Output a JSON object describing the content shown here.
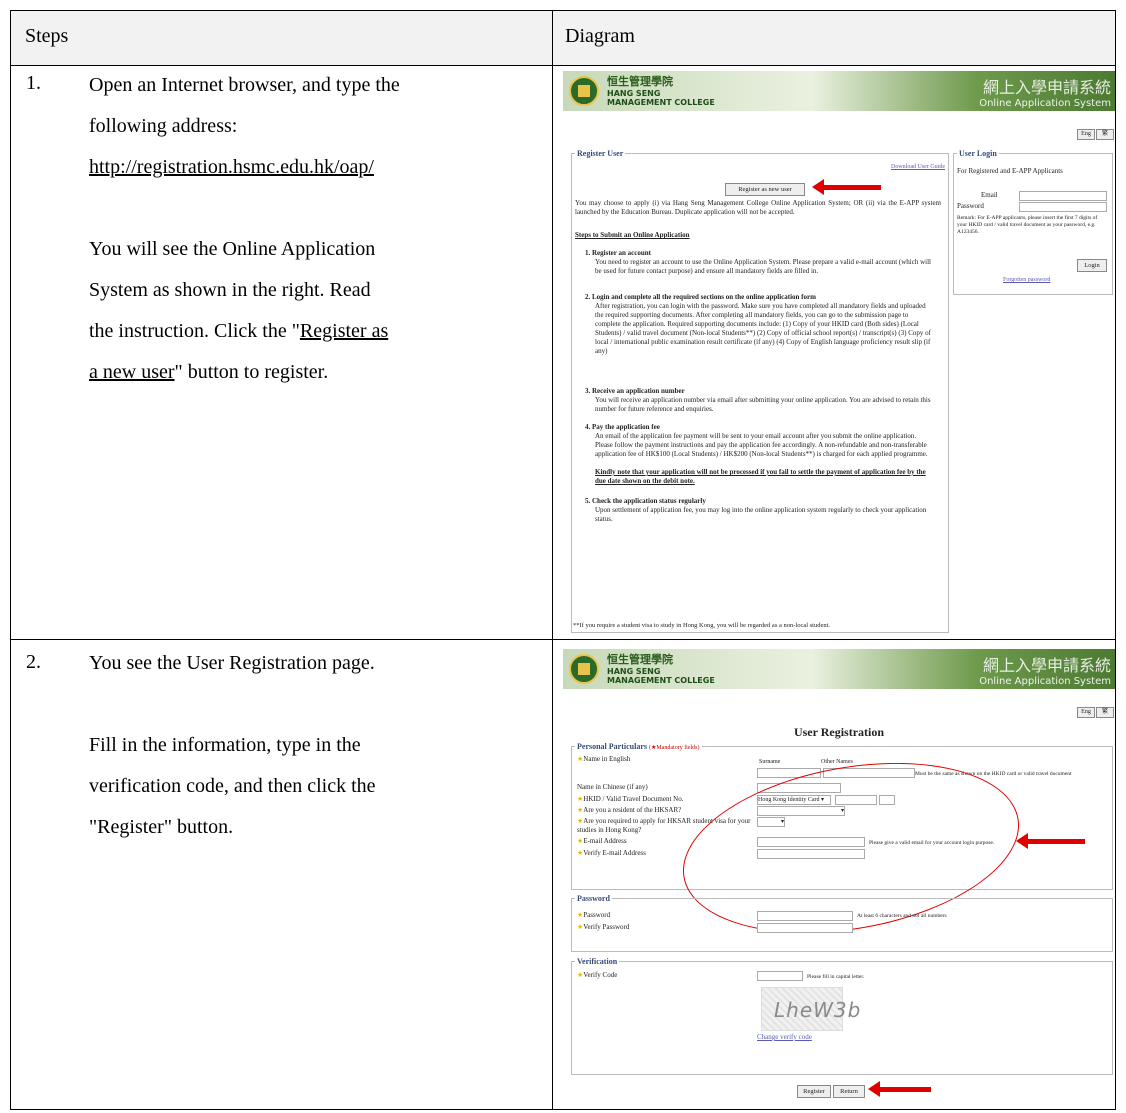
{
  "table": {
    "header_steps": "Steps",
    "header_diagram": "Diagram"
  },
  "step1": {
    "number": "1.",
    "line1": "Open an Internet browser, and type the",
    "line2": "following address:",
    "url": "http://registration.hsmc.edu.hk/oap/",
    "line4": "You will see the Online Application",
    "line5a": "System as shown in the right.   Read",
    "line6a": "the instruction.   Click the \"",
    "line6link": "Register as",
    "line7link": "a new user",
    "line7b": "\" button to register."
  },
  "step2": {
    "number": "2.",
    "line1": "You see the User Registration page.",
    "line2": "Fill in the information, type in the",
    "line3": "verification code, and then click the",
    "line4": "\"Register\" button."
  },
  "banner": {
    "college_zh": "恒生管理學院",
    "college_en1": "HANG SENG",
    "college_en2": "MANAGEMENT COLLEGE",
    "system_zh": "網上入學申請系統",
    "system_en": "Online Application System",
    "lang1": "Eng",
    "lang2": "繁"
  },
  "shot1": {
    "register_user_title": "Register User",
    "download_guide": "Download User Guide",
    "register_button": "Register as new user",
    "intro": "You may choose to apply (i) via Hang Seng Management College Online Application System; OR (ii) via the E-APP system launched by the Education Bureau. Duplicate application will not be accepted.",
    "steps_heading": "Steps to Submit an Online Application",
    "s1_title": "1.  Register an account",
    "s1_body": "You need to register an account to use the Online Application System. Please prepare a valid e-mail account (which will be used for future contact purpose) and ensure all mandatory fields are filled in.",
    "s2_title": "2.  Login and complete all the required sections on the online application form",
    "s2_body": "After registration, you can login with the password. Make sure you have completed all mandatory fields and uploaded the required supporting documents. After completing all mandatory fields, you can go to the submission page to complete the application. Required supporting documents include: (1) Copy of your HKID card (Both sides) (Local Students) / valid travel document (Non-local Students**) (2) Copy of official school report(s) / transcript(s) (3) Copy of local / international public examination result certificate (if any) (4) Copy of English language proficiency result slip (if any)",
    "s3_title": "3.  Receive an application number",
    "s3_body": "You will receive an application number via email after submitting your online application. You are advised to retain this number for future reference and enquiries.",
    "s4_title": "4.  Pay the application fee",
    "s4_body": "An email of the application fee payment will be sent to your email account after you submit the online application. Please follow the payment instructions and pay the application fee accordingly. A non-refundable and non-transferable application fee of HK$100 (Local Students) / HK$200 (Non-local Students**) is charged for each applied programme.",
    "s4_bold": "Kindly note that your application will not be processed if you fail to settle the payment of application fee by the due date shown on the debit note.",
    "s5_title": "5.  Check the application status regularly",
    "s5_body": "Upon settlement of application fee, you may log into the online application system regularly to check your application status.",
    "footnote": "**If you require a student visa to study in Hong Kong, you will be regarded as a non-local student.",
    "login_title": "User Login",
    "login_sub": "For Registered and E-APP Applicants",
    "email_label": "Email",
    "password_label": "Password",
    "remark": "Remark: For E-APP applicants, please insert the first 7 digits of your HKID card / valid travel document as your password, e.g. A123456.",
    "login_button": "Login",
    "forgotten": "Forgotten password"
  },
  "shot2": {
    "title": "User Registration",
    "personal_title": "Personal Particulars",
    "mandatory_note": "(★Mandatory fields)",
    "name_en": "Name in English",
    "surname": "Surname",
    "other_names": "Other Names",
    "name_note": "Must be the same as shown on the HKID card or valid travel document",
    "name_zh": "Name in Chinese (if any)",
    "hkid": "HKID / Valid Travel Document No.",
    "hkid_select": "Hong Kong Identity Card",
    "resident": "Are you a resident of the HKSAR?",
    "visa": "Are you required to apply for HKSAR student visa for your studies in Hong Kong?",
    "email": "E-mail Address",
    "email_note": "Please give a valid email for your account login purpose.",
    "verify_email": "Verify E-mail Address",
    "password_title": "Password",
    "password": "Password",
    "password_note": "At least 6 characters and not all numbers",
    "verify_password": "Verify Password",
    "verification_title": "Verification",
    "verify_code": "Verify Code",
    "code_note": "Please fill in capital letter.",
    "captcha": "LheW3b",
    "change_code": "Change verify code",
    "register_button": "Register",
    "return_button": "Return"
  }
}
